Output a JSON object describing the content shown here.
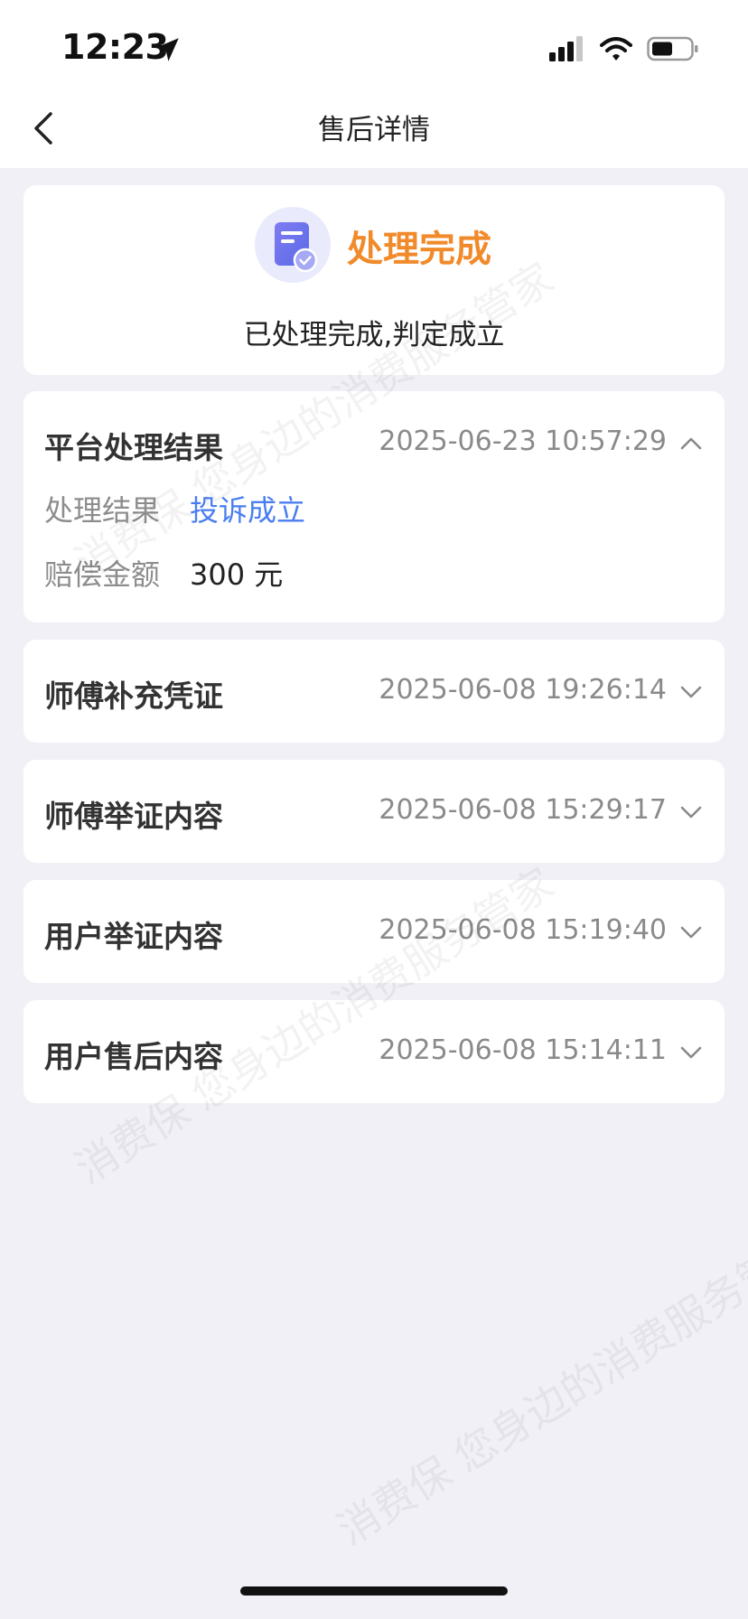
{
  "status_bar": {
    "time": "12:23"
  },
  "header": {
    "title": "售后详情"
  },
  "status_card": {
    "title": "处理完成",
    "description": "已处理完成,判定成立"
  },
  "result": {
    "title": "平台处理结果",
    "time": "2025-06-23 10:57:29",
    "rows": [
      {
        "label": "处理结果",
        "value": "投诉成立"
      },
      {
        "label": "赔偿金额",
        "value": "300 元"
      }
    ]
  },
  "sections": [
    {
      "title": "师傅补充凭证",
      "time": "2025-06-08 19:26:14"
    },
    {
      "title": "师傅举证内容",
      "time": "2025-06-08 15:29:17"
    },
    {
      "title": "用户举证内容",
      "time": "2025-06-08 15:19:40"
    },
    {
      "title": "用户售后内容",
      "time": "2025-06-08 15:14:11"
    }
  ],
  "watermark": "消费保 您身边的消费服务管家",
  "colors": {
    "accent_orange": "#f08a2a",
    "link_blue": "#4a7ef0",
    "background": "#f1f0f6"
  }
}
